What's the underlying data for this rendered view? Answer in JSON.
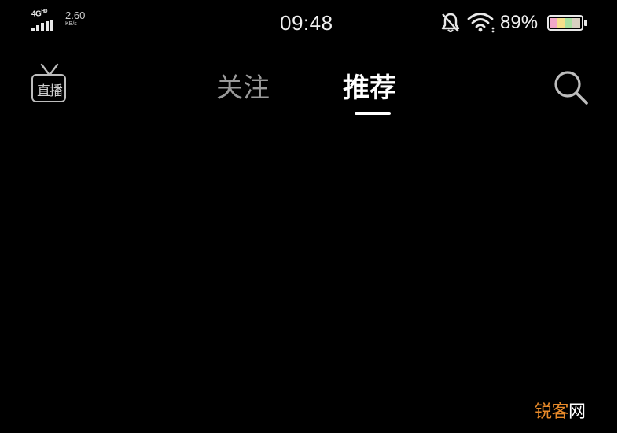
{
  "status_bar": {
    "network": "4G",
    "network_badge": "HD",
    "speed_value": "2.60",
    "speed_unit": "KB/s",
    "time": "09:48",
    "battery_percent": "89%",
    "battery_level": 0.89,
    "icons": [
      "signal-icon",
      "silent-bell-icon",
      "wifi-icon",
      "battery-icon"
    ]
  },
  "top_nav": {
    "live_label": "直播",
    "tabs": [
      {
        "label": "关注",
        "active": false
      },
      {
        "label": "推荐",
        "active": true
      }
    ],
    "search_icon": "search-icon"
  },
  "watermark": {
    "text_main": "锐客",
    "text_end": "网"
  },
  "colors": {
    "background": "#000000",
    "active_tab": "#ffffff",
    "inactive_tab": "#9a9a9a",
    "watermark": "#e88a2a"
  }
}
